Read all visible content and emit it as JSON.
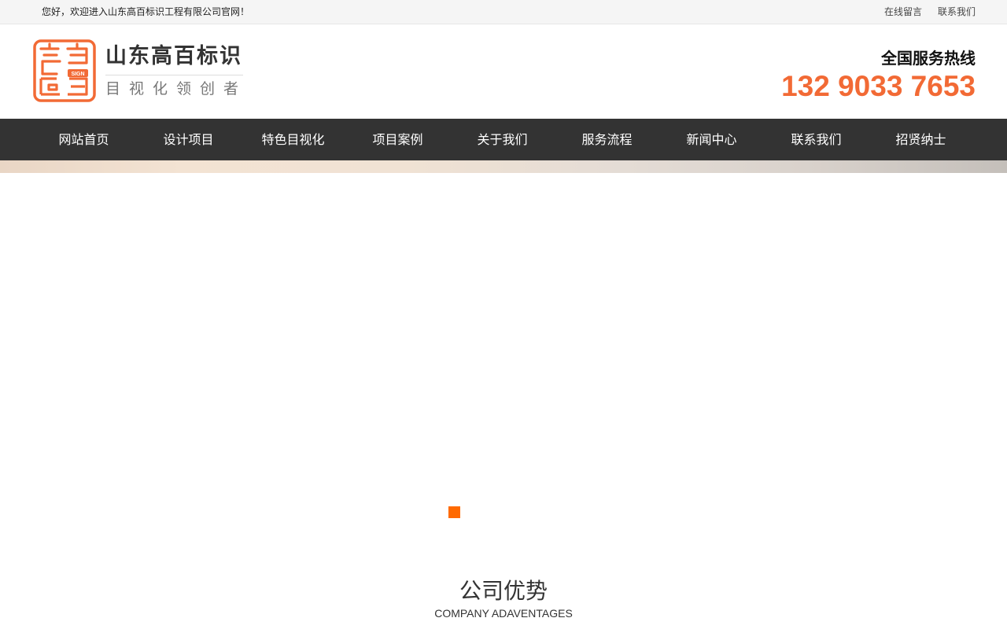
{
  "topbar": {
    "welcome": "您好，欢迎进入山东高百标识工程有限公司官网！",
    "links": [
      {
        "label": "在线留言"
      },
      {
        "label": "联系我们"
      }
    ]
  },
  "logo": {
    "name": "山东高百标识",
    "slogan": "目视化领创者",
    "mark_text": "SIGN",
    "mark_color": "#f26a35"
  },
  "hotline": {
    "label": "全国服务热线",
    "number": "132 9033 7653",
    "color": "#f26a35"
  },
  "nav": {
    "items": [
      {
        "label": "网站首页"
      },
      {
        "label": "设计项目"
      },
      {
        "label": "特色目视化"
      },
      {
        "label": "项目案例"
      },
      {
        "label": "关于我们"
      },
      {
        "label": "服务流程"
      },
      {
        "label": "新闻中心"
      },
      {
        "label": "联系我们"
      },
      {
        "label": "招贤纳士"
      }
    ],
    "background": "#333333"
  },
  "slider": {
    "active_dot_color": "#ff6a00"
  },
  "section": {
    "title_cn": "公司优势",
    "title_en": "COMPANY ADAVENTAGES"
  }
}
